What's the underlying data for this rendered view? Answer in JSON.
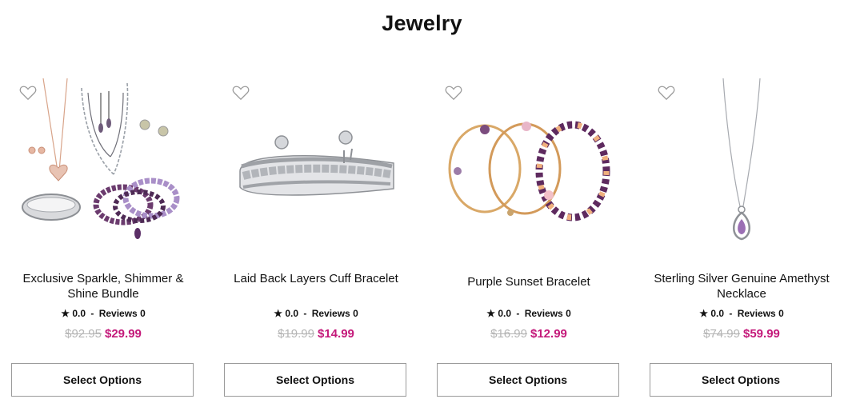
{
  "page": {
    "title": "Jewelry"
  },
  "colors": {
    "sale_price": "#c4197a",
    "old_price": "#b5b5b5",
    "button_border": "#9a9a9a"
  },
  "products": [
    {
      "name": "Exclusive Sparkle, Shimmer & Shine Bundle",
      "rating": "0.0",
      "reviews_label": "Reviews",
      "reviews_count": "0",
      "old_price": "$92.95",
      "price": "$29.99",
      "button": "Select Options",
      "image": "jewelry-bundle-image",
      "wishlist_icon": "heart-outline-icon"
    },
    {
      "name": "Laid Back Layers Cuff Bracelet",
      "rating": "0.0",
      "reviews_label": "Reviews",
      "reviews_count": "0",
      "old_price": "$19.99",
      "price": "$14.99",
      "button": "Select Options",
      "image": "silver-cuff-bracelet-image",
      "wishlist_icon": "heart-outline-icon"
    },
    {
      "name": "Purple Sunset Bracelet",
      "rating": "0.0",
      "reviews_label": "Reviews",
      "reviews_count": "0",
      "old_price": "$16.99",
      "price": "$12.99",
      "button": "Select Options",
      "image": "beaded-bracelet-image",
      "wishlist_icon": "heart-outline-icon"
    },
    {
      "name": "Sterling Silver Genuine Amethyst Necklace",
      "rating": "0.0",
      "reviews_label": "Reviews",
      "reviews_count": "0",
      "old_price": "$74.99",
      "price": "$59.99",
      "button": "Select Options",
      "image": "amethyst-necklace-image",
      "wishlist_icon": "heart-outline-icon"
    }
  ]
}
